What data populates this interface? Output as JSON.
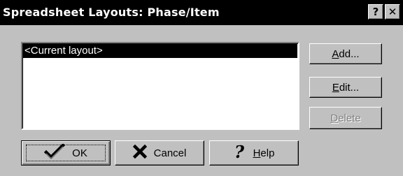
{
  "window": {
    "title": "Spreadsheet Layouts: Phase/Item",
    "help_button": "?",
    "close_button": "✕"
  },
  "list": {
    "items": [
      "<Current layout>"
    ],
    "selected_index": 0
  },
  "buttons": {
    "add": {
      "mnemonic": "A",
      "rest": "dd..."
    },
    "edit": {
      "mnemonic": "E",
      "rest": "dit..."
    },
    "delete": {
      "mnemonic": "D",
      "rest": "elete",
      "enabled": false
    },
    "ok": {
      "label": "OK",
      "icon": "checkmark-icon"
    },
    "cancel": {
      "label": "Cancel",
      "icon": "x-icon"
    },
    "help": {
      "mnemonic": "H",
      "rest": "elp",
      "icon": "question-mark-icon"
    }
  },
  "colors": {
    "face": "#c0c0c0",
    "title_bar": "#000000",
    "selection": "#000000"
  }
}
